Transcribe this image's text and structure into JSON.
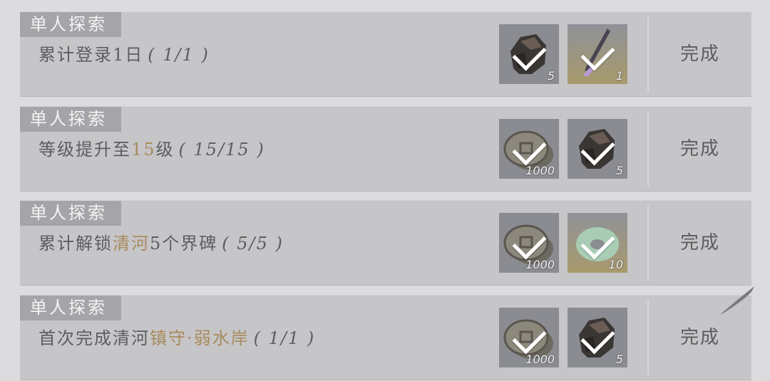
{
  "tasks": [
    {
      "tag": "单人探索",
      "desc_parts": [
        {
          "text": "累计登录1日",
          "hl": false
        }
      ],
      "progress": "( 1/1 )",
      "rewards": [
        {
          "icon": "stone-icon",
          "count": "5"
        },
        {
          "icon": "feather-brush-icon",
          "count": "1"
        }
      ],
      "status": "完成"
    },
    {
      "tag": "单人探索",
      "desc_parts": [
        {
          "text": "等级提升至",
          "hl": false
        },
        {
          "text": "15",
          "hl": true
        },
        {
          "text": "级",
          "hl": false
        }
      ],
      "progress": "( 15/15 )",
      "rewards": [
        {
          "icon": "coins-icon",
          "count": "1000"
        },
        {
          "icon": "stone-icon",
          "count": "5"
        }
      ],
      "status": "完成"
    },
    {
      "tag": "单人探索",
      "desc_parts": [
        {
          "text": "累计解锁",
          "hl": false
        },
        {
          "text": "清河",
          "hl": true
        },
        {
          "text": "5个界碑",
          "hl": false
        }
      ],
      "progress": "( 5/5 )",
      "rewards": [
        {
          "icon": "coins-icon",
          "count": "1000"
        },
        {
          "icon": "jade-icon",
          "count": "10"
        }
      ],
      "status": "完成"
    },
    {
      "tag": "单人探索",
      "desc_parts": [
        {
          "text": "首次完成清河",
          "hl": false
        },
        {
          "text": "镇守·弱水岸",
          "hl": true
        }
      ],
      "progress": "( 1/1 )",
      "rewards": [
        {
          "icon": "coins-icon",
          "count": "1000"
        },
        {
          "icon": "stone-icon",
          "count": "5"
        }
      ],
      "status": "完成"
    }
  ]
}
